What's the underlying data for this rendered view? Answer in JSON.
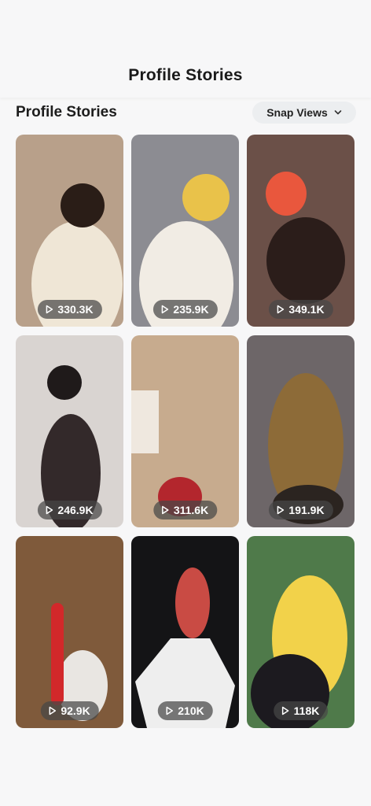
{
  "header": {
    "title": "Profile Stories"
  },
  "section": {
    "title": "Profile Stories",
    "sort_label": "Snap Views"
  },
  "stories": [
    {
      "views": "330.3K",
      "bg": "#b8a08a",
      "accent": "#efe6d6",
      "figure": "#2a1d17"
    },
    {
      "views": "235.9K",
      "bg": "#8c8c92",
      "accent": "#f1ece4",
      "figure": "#e9c24a"
    },
    {
      "views": "349.1K",
      "bg": "#6b5048",
      "accent": "#e9573d",
      "figure": "#2b1d1a"
    },
    {
      "views": "246.9K",
      "bg": "#d9d4d1",
      "accent": "#33292a",
      "figure": "#1f1a1a"
    },
    {
      "views": "311.6K",
      "bg": "#c7ab8e",
      "accent": "#efe8df",
      "figure": "#b3262d"
    },
    {
      "views": "191.9K",
      "bg": "#6d6668",
      "accent": "#8d6b38",
      "figure": "#2b2420"
    },
    {
      "views": "92.9K",
      "bg": "#7f5a3b",
      "accent": "#e9e6e2",
      "figure": "#d2282a"
    },
    {
      "views": "210K",
      "bg": "#141416",
      "accent": "#eeeeee",
      "figure": "#c94b44"
    },
    {
      "views": "118K",
      "bg": "#4f7a4a",
      "accent": "#f2d24a",
      "figure": "#1c1a1f"
    }
  ]
}
